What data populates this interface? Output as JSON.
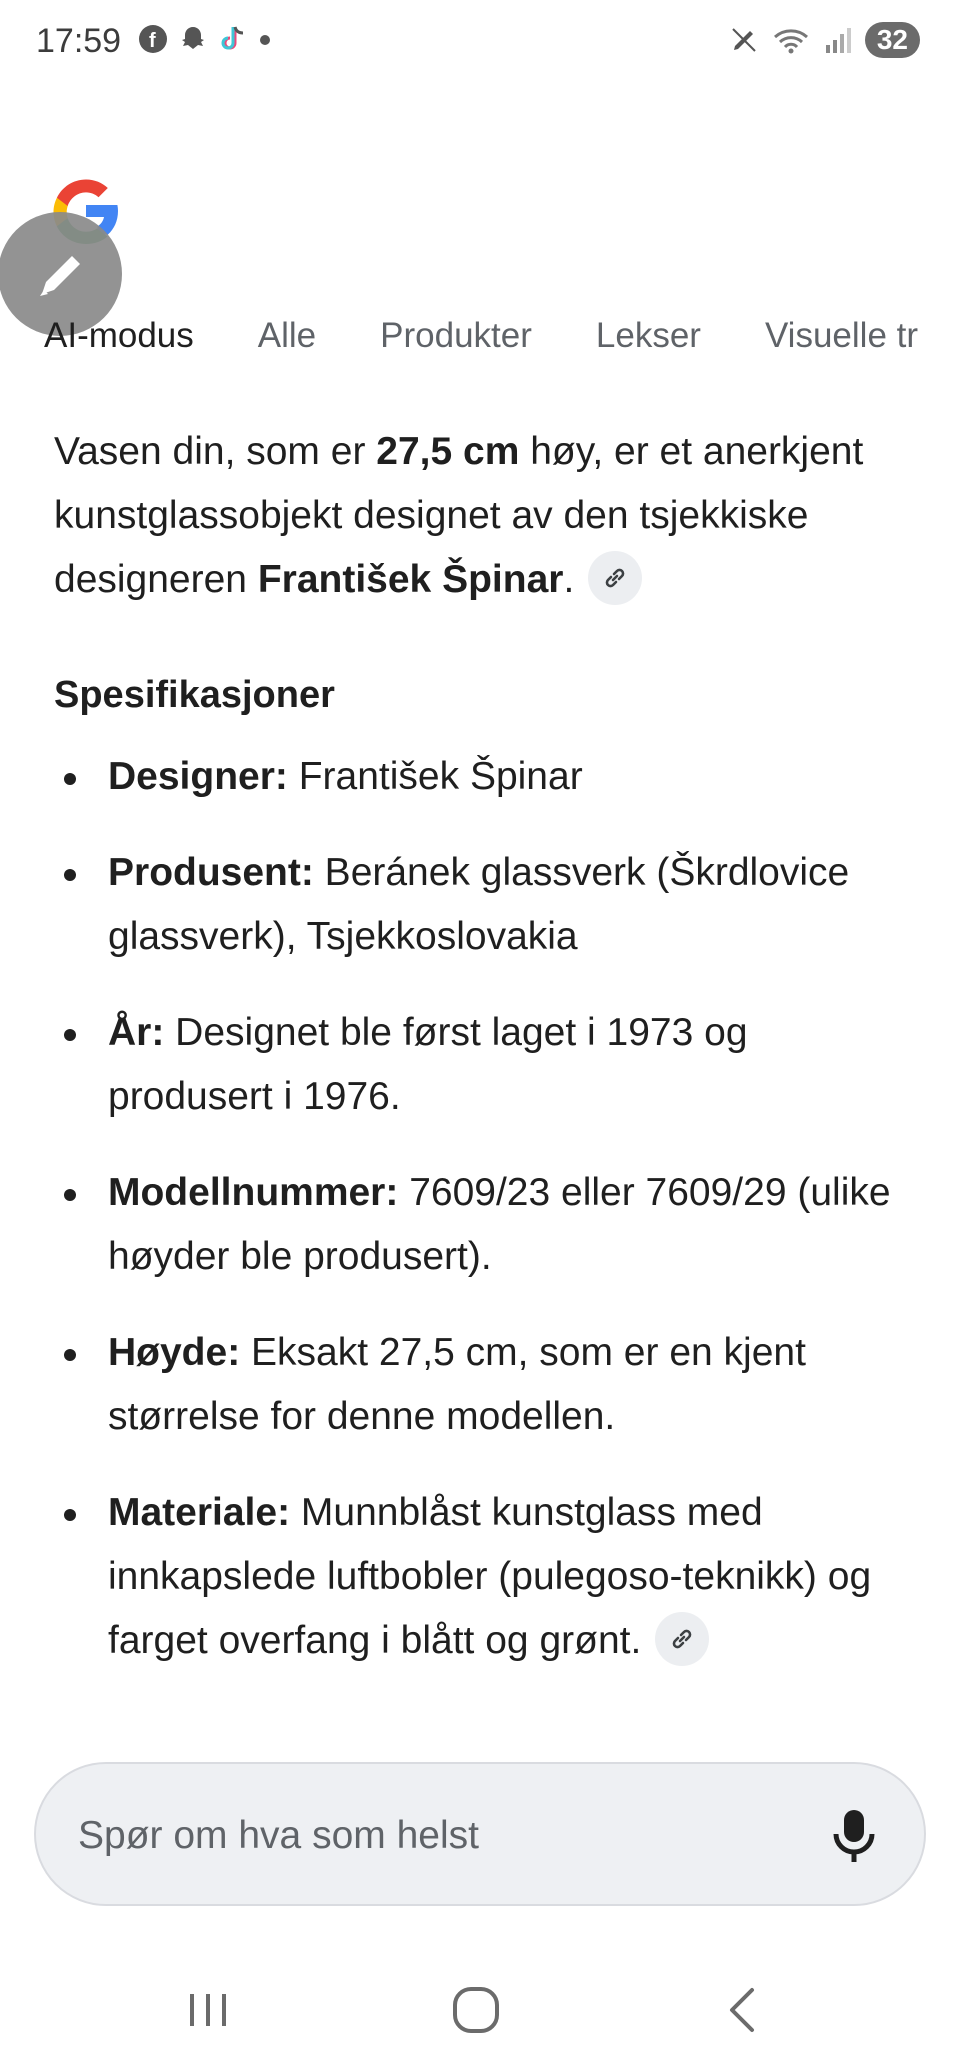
{
  "status_bar": {
    "time": "17:59",
    "battery": "32",
    "app_icons": [
      "facebook-icon",
      "snapchat-icon",
      "tiktok-icon",
      "dot-icon"
    ]
  },
  "tabs": [
    {
      "label": "AI-modus",
      "active": true
    },
    {
      "label": "Alle",
      "active": false
    },
    {
      "label": "Produkter",
      "active": false
    },
    {
      "label": "Lekser",
      "active": false
    },
    {
      "label": "Visuelle tr",
      "active": false
    }
  ],
  "intro": {
    "part1": "Vasen din, som er ",
    "height_bold": "27,5 cm",
    "part2": " høy, er et anerkjent kunstglassobjekt designet av den tsjekkiske designeren ",
    "designer_bold": "František Špinar",
    "part3": "."
  },
  "section_title": "Spesifikasjoner",
  "specs": [
    {
      "label": "Designer:",
      "value": " František Špinar"
    },
    {
      "label": "Produsent:",
      "value": " Beránek glassverk (Škrdlovice glassverk), Tsjekkoslovakia"
    },
    {
      "label": "År:",
      "value": " Designet ble først laget i 1973 og produsert i 1976."
    },
    {
      "label": "Modellnummer:",
      "value": " 7609/23 eller 7609/29 (ulike høyder ble produsert)."
    },
    {
      "label": "Høyde:",
      "value": " Eksakt 27,5 cm, som er en kjent størrelse for denne modellen."
    },
    {
      "label": "Materiale:",
      "value": " Munnblåst kunstglass med innkapslede luftbobler (pulegoso-teknikk) og farget overfang i blått og grønt."
    }
  ],
  "ask_bar": {
    "placeholder": "Spør om hva som helst"
  }
}
